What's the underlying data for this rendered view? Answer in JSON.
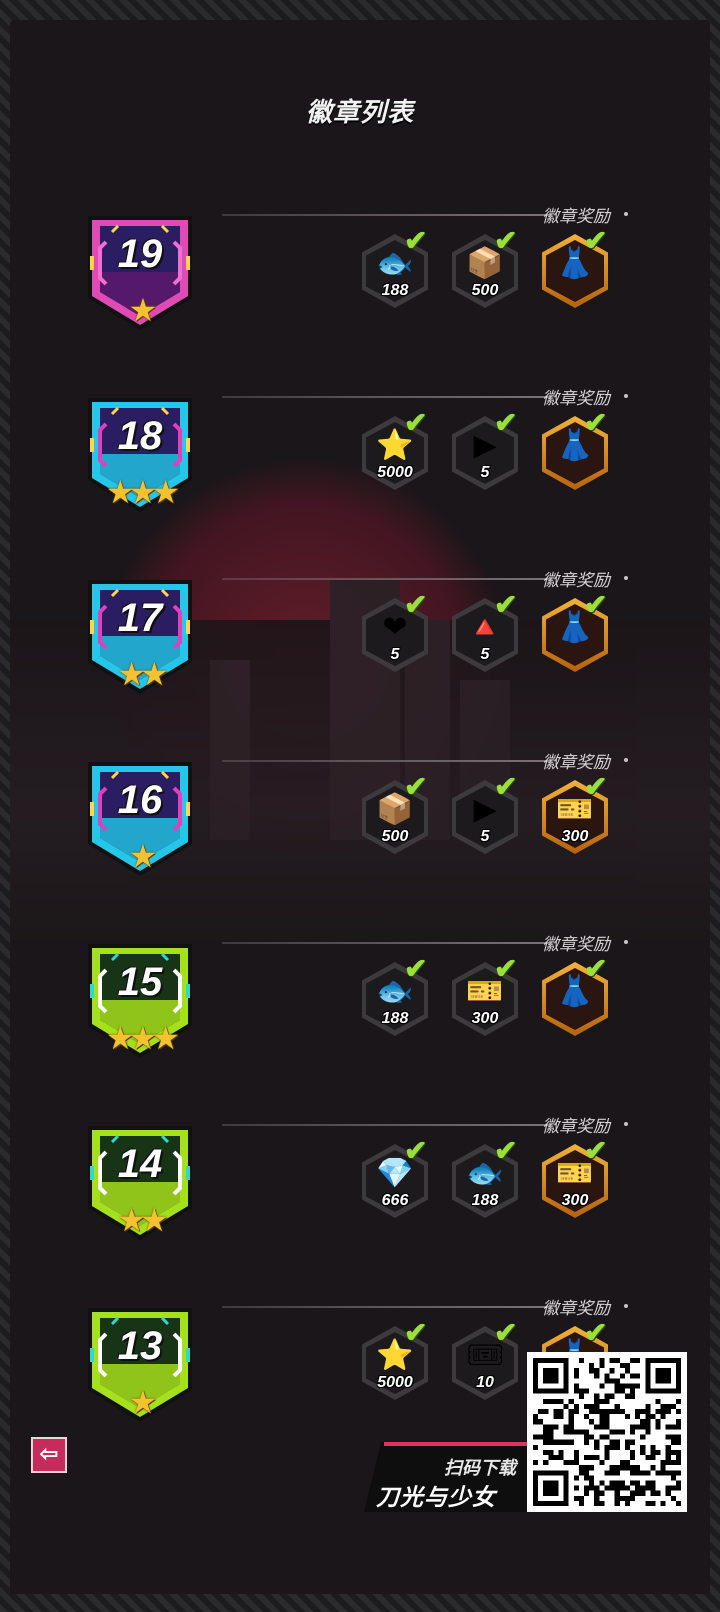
{
  "title": "徽章列表",
  "reward_label": "徽章奖励",
  "badges": [
    {
      "level": "19",
      "stars": "★",
      "theme": "purple",
      "items": [
        {
          "name": "fish-icon",
          "qty": "188",
          "gold": false
        },
        {
          "name": "tofu-box-icon",
          "qty": "500",
          "gold": false
        },
        {
          "name": "outfit-icon",
          "qty": "",
          "gold": true
        }
      ]
    },
    {
      "level": "18",
      "stars": "★★★",
      "theme": "cyan-purple",
      "items": [
        {
          "name": "star-coin-icon",
          "qty": "5000",
          "gold": false
        },
        {
          "name": "ticket-box-icon",
          "qty": "5",
          "gold": false
        },
        {
          "name": "outfit-icon",
          "qty": "",
          "gold": true
        }
      ]
    },
    {
      "level": "17",
      "stars": "★★",
      "theme": "cyan-purple",
      "items": [
        {
          "name": "heart-up-icon",
          "qty": "5",
          "gold": false
        },
        {
          "name": "pie-up-icon",
          "qty": "5",
          "gold": false
        },
        {
          "name": "outfit-icon",
          "qty": "",
          "gold": true
        }
      ]
    },
    {
      "level": "16",
      "stars": "★",
      "theme": "cyan-purple",
      "items": [
        {
          "name": "tofu-box-icon",
          "qty": "500",
          "gold": false
        },
        {
          "name": "ticket-box-icon",
          "qty": "5",
          "gold": false
        },
        {
          "name": "d-card-icon",
          "qty": "300",
          "gold": true
        }
      ]
    },
    {
      "level": "15",
      "stars": "★★★",
      "theme": "green",
      "items": [
        {
          "name": "fish-icon",
          "qty": "188",
          "gold": false
        },
        {
          "name": "d-card-icon",
          "qty": "300",
          "gold": false
        },
        {
          "name": "outfit-icon",
          "qty": "",
          "gold": true
        }
      ]
    },
    {
      "level": "14",
      "stars": "★★",
      "theme": "green",
      "items": [
        {
          "name": "crystal-icon",
          "qty": "666",
          "gold": false
        },
        {
          "name": "fish-icon",
          "qty": "188",
          "gold": false
        },
        {
          "name": "d-card-icon",
          "qty": "300",
          "gold": true
        }
      ]
    },
    {
      "level": "13",
      "stars": "★",
      "theme": "green",
      "items": [
        {
          "name": "star-coin-icon",
          "qty": "5000",
          "gold": false
        },
        {
          "name": "ticket-icon",
          "qty": "10",
          "gold": false
        },
        {
          "name": "outfit-icon",
          "qty": "",
          "gold": true
        }
      ]
    }
  ],
  "icons": {
    "fish-icon": "🐟",
    "tofu-box-icon": "📦",
    "outfit-icon": "👗",
    "star-coin-icon": "⭐",
    "ticket-box-icon": "▶",
    "heart-up-icon": "❤",
    "pie-up-icon": "🔺",
    "d-card-icon": "🎫",
    "crystal-icon": "💎",
    "ticket-icon": "🎟"
  },
  "check_glyph": "✔",
  "back_glyph": "⇦",
  "download": {
    "label": "扫码下载",
    "app_name": "刀光与少女"
  },
  "colors": {
    "accent": "#c72b5b",
    "check": "#9be03a",
    "star": "#f2c230"
  }
}
